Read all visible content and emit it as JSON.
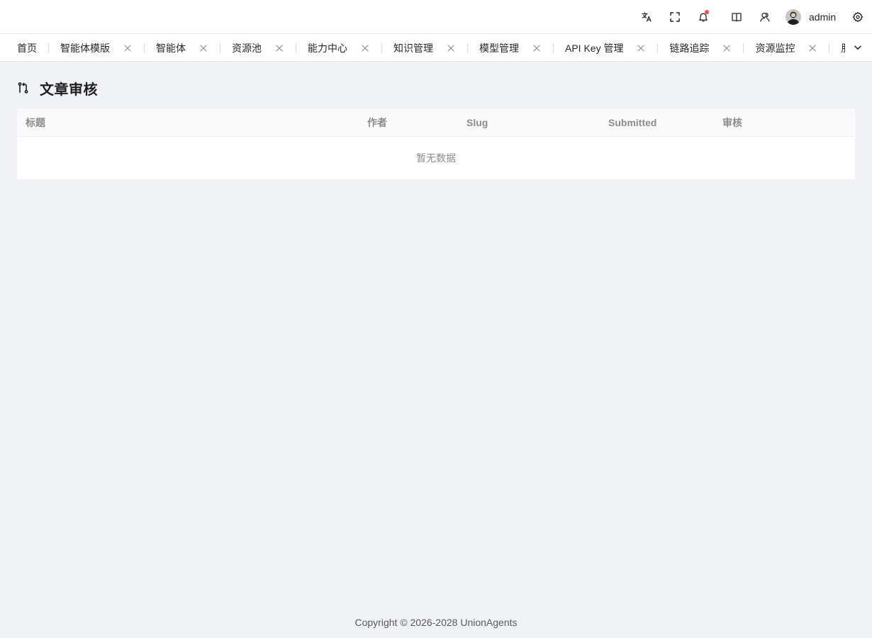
{
  "header": {
    "icons": [
      "translate-icon",
      "fullscreen-icon",
      "bell-icon",
      "book-icon",
      "user-outline-icon",
      "gear-icon"
    ],
    "user_name": "admin",
    "notification_dot_color": "#ff4d4f"
  },
  "tabs": [
    {
      "label": "首页",
      "closable": false
    },
    {
      "label": "智能体模版",
      "closable": true
    },
    {
      "label": "智能体",
      "closable": true
    },
    {
      "label": "资源池",
      "closable": true
    },
    {
      "label": "能力中心",
      "closable": true
    },
    {
      "label": "知识管理",
      "closable": true
    },
    {
      "label": "模型管理",
      "closable": true
    },
    {
      "label": "API Key 管理",
      "closable": true
    },
    {
      "label": "链路追踪",
      "closable": true
    },
    {
      "label": "资源监控",
      "closable": true
    },
    {
      "label": "服务",
      "closable": false
    }
  ],
  "page": {
    "title": "文章审核",
    "icon": "pull-request-icon"
  },
  "table": {
    "columns": [
      "标题",
      "作者",
      "Slug",
      "Submitted",
      "审核"
    ],
    "empty_text": "暂无数据"
  },
  "footer": {
    "copyright": "Copyright © 2026-2028 UnionAgents"
  }
}
